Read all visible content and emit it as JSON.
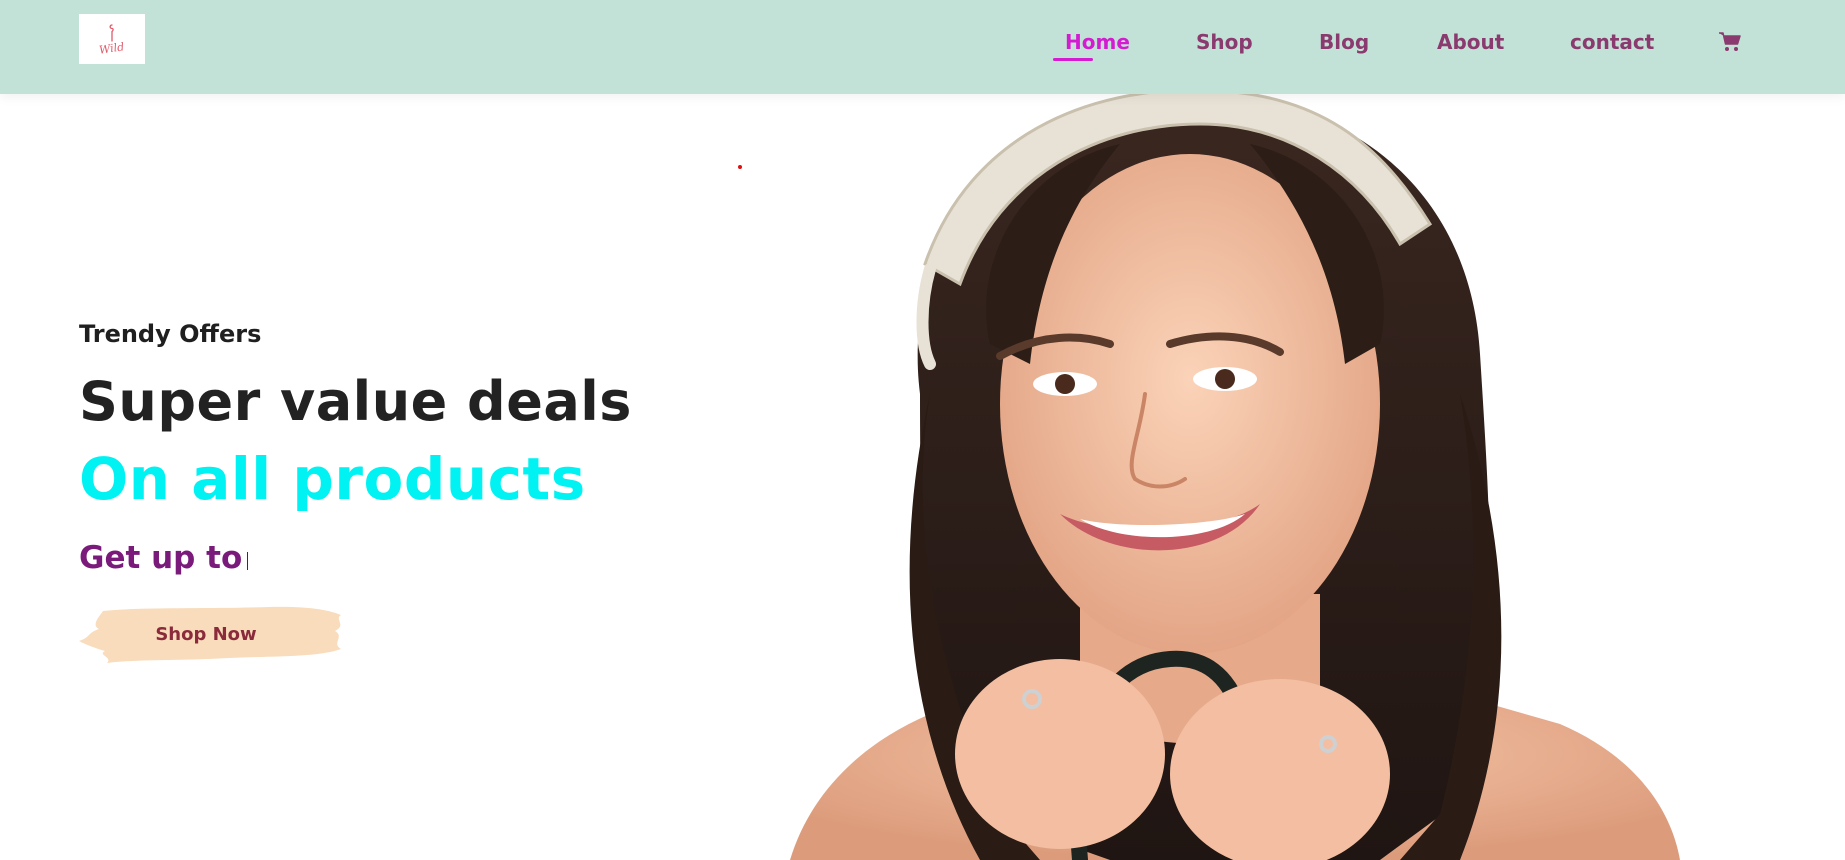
{
  "brand": {
    "logo_text": "Wild"
  },
  "nav": {
    "items": [
      {
        "label": "Home",
        "active": true
      },
      {
        "label": "Shop",
        "active": false
      },
      {
        "label": "Blog",
        "active": false
      },
      {
        "label": "About",
        "active": false
      },
      {
        "label": "contact",
        "active": false
      }
    ],
    "cart_icon": "shopping-cart-icon"
  },
  "hero": {
    "tagline": "Trendy Offers",
    "headline": "Super value deals",
    "subheadline": "On all products",
    "offer_text": "Get up to",
    "cta_label": "Shop Now",
    "image": "smiling-girl-holding-shopping-bag"
  },
  "colors": {
    "header_bg": "#c3e2d7",
    "nav_text": "#8a3a6e",
    "nav_active": "#d41bd1",
    "headline": "#222222",
    "subheadline": "#00f2f2",
    "offer_text": "#7a1a7a",
    "cta_bg": "#f8dcbc",
    "cta_text": "#8a2a3a"
  }
}
